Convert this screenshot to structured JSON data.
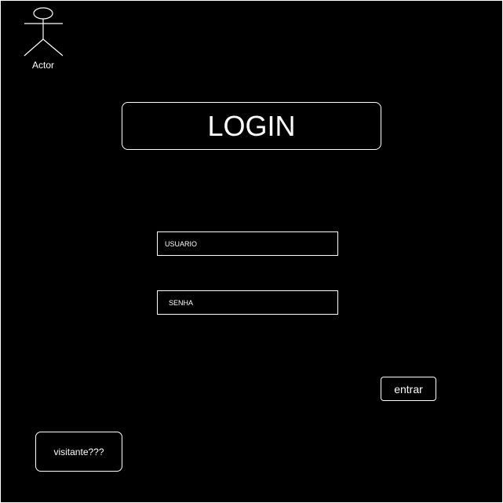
{
  "actor": {
    "label": "Actor",
    "icon": "stick-figure-actor-icon"
  },
  "login": {
    "title": "LOGIN",
    "username_label": "USUARIO",
    "password_label": "SENHA",
    "submit_label": "entrar",
    "guest_label": "visitante???"
  },
  "colors": {
    "background": "#000000",
    "foreground": "#ffffff"
  }
}
